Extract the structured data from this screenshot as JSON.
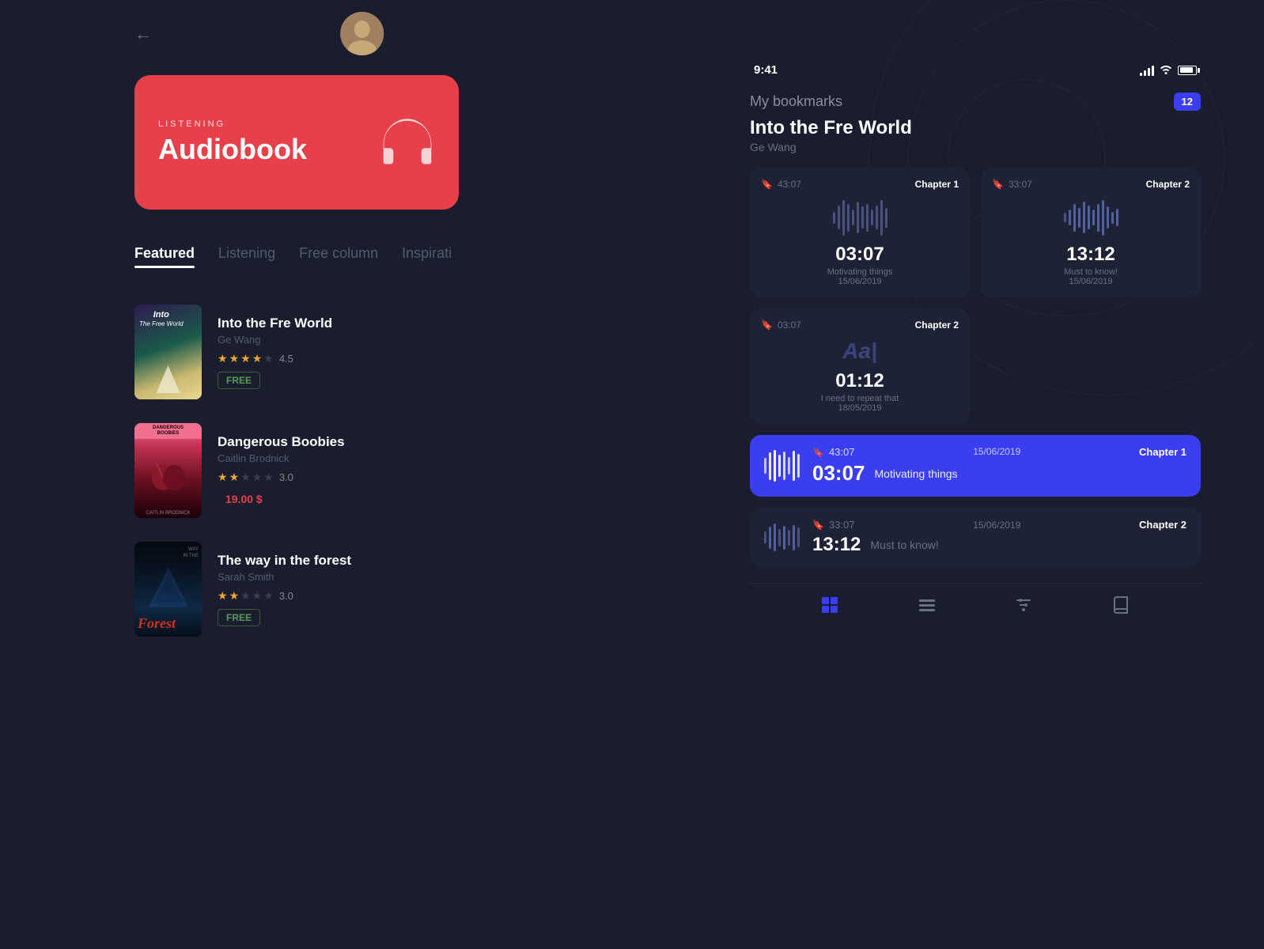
{
  "app": {
    "title": "Listening Audiobook",
    "hero": {
      "label": "LISTENING",
      "title": "Audiobook"
    }
  },
  "left_panel": {
    "back_label": "←",
    "tabs": [
      {
        "id": "featured",
        "label": "Featured",
        "active": true
      },
      {
        "id": "listening",
        "label": "Listening",
        "active": false
      },
      {
        "id": "free_column",
        "label": "Free column",
        "active": false
      },
      {
        "id": "inspirati",
        "label": "Inspirati",
        "active": false
      }
    ],
    "books": [
      {
        "title": "Into the Fre World",
        "author": "Ge Wang",
        "rating": 4.5,
        "price_type": "free",
        "price_label": "FREE"
      },
      {
        "title": "Dangerous Boobies",
        "author": "Caitlin Brodnick",
        "rating": 3.0,
        "price_type": "paid",
        "price_label": "19.00 $"
      },
      {
        "title": "The way in the forest",
        "author": "Sarah Smith",
        "rating": 3.0,
        "price_type": "free",
        "price_label": "FREE"
      }
    ]
  },
  "right_panel": {
    "status": {
      "time": "9:41"
    },
    "header": {
      "title": "My bookmarks",
      "count": "12"
    },
    "book": {
      "title": "Into the Fre World",
      "author": "Ge Wang"
    },
    "bookmarks": [
      {
        "id": "bm1",
        "duration": "43:07",
        "chapter": "Chapter 1",
        "time": "03:07",
        "description": "Motivating things",
        "date": "15/06/2019",
        "active": false
      },
      {
        "id": "bm2",
        "duration": "33:07",
        "chapter": "Chapter 2",
        "time": "13:12",
        "description": "Must to know!",
        "date": "15/06/2019",
        "active": false
      },
      {
        "id": "bm3",
        "duration": "03:07",
        "chapter": "Chapter 2",
        "time": "01:12",
        "description": "I need to repeat that",
        "date": "18/05/2019",
        "active": false,
        "text_type": true
      }
    ],
    "active_bookmark": {
      "duration": "43:07",
      "date": "15/06/2019",
      "chapter": "Chapter 1",
      "time": "03:07",
      "description": "Motivating things"
    },
    "last_bookmark": {
      "duration": "33:07",
      "date": "15/06/2019",
      "chapter": "Chapter 2",
      "time": "13:12",
      "description": "Must to know!"
    },
    "nav": {
      "items": [
        {
          "id": "grid",
          "icon": "⊞",
          "active": true
        },
        {
          "id": "list",
          "icon": "≡",
          "active": false
        },
        {
          "id": "filter",
          "icon": "⫶",
          "active": false
        },
        {
          "id": "book",
          "icon": "📖",
          "active": false
        }
      ]
    }
  }
}
